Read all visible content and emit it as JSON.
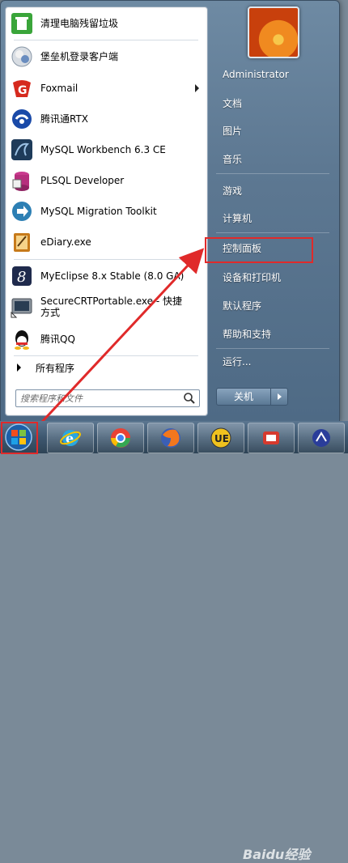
{
  "left_pane": {
    "programs": [
      {
        "label": "清理电脑残留垃圾",
        "icon": "recycle-icon"
      },
      {
        "label": "堡垒机登录客户端",
        "icon": "bastion-client-icon"
      },
      {
        "label": "Foxmail",
        "icon": "foxmail-icon",
        "has_submenu": true
      },
      {
        "label": "腾讯通RTX",
        "icon": "rtx-icon"
      },
      {
        "label": "MySQL Workbench 6.3 CE",
        "icon": "mysql-workbench-icon"
      },
      {
        "label": "PLSQL Developer",
        "icon": "plsql-developer-icon"
      },
      {
        "label": "MySQL Migration Toolkit",
        "icon": "mysql-migration-icon"
      },
      {
        "label": "eDiary.exe",
        "icon": "ediary-icon"
      },
      {
        "label": "MyEclipse 8.x Stable (8.0 GA)",
        "icon": "myeclipse-icon"
      },
      {
        "label_line1": "SecureCRTPortable.exe - 快捷",
        "label_line2": "方式",
        "icon": "securecrt-icon"
      },
      {
        "label": "腾讯QQ",
        "icon": "qq-icon"
      }
    ],
    "all_programs": "所有程序",
    "search_placeholder": "搜索程序和文件"
  },
  "right_pane": {
    "user": "Administrator",
    "items": [
      "文档",
      "图片",
      "音乐",
      "游戏",
      "计算机",
      "控制面板",
      "设备和打印机",
      "默认程序",
      "帮助和支持",
      "运行..."
    ],
    "shutdown": "关机"
  },
  "taskbar": {
    "apps": [
      "start-orb-icon",
      "internet-explorer-icon",
      "chrome-icon",
      "firefox-icon",
      "ultraedit-icon",
      "app-icon",
      "app-icon"
    ]
  },
  "watermark": "Baidu经验",
  "colors": {
    "highlight": "#e02a2a"
  }
}
